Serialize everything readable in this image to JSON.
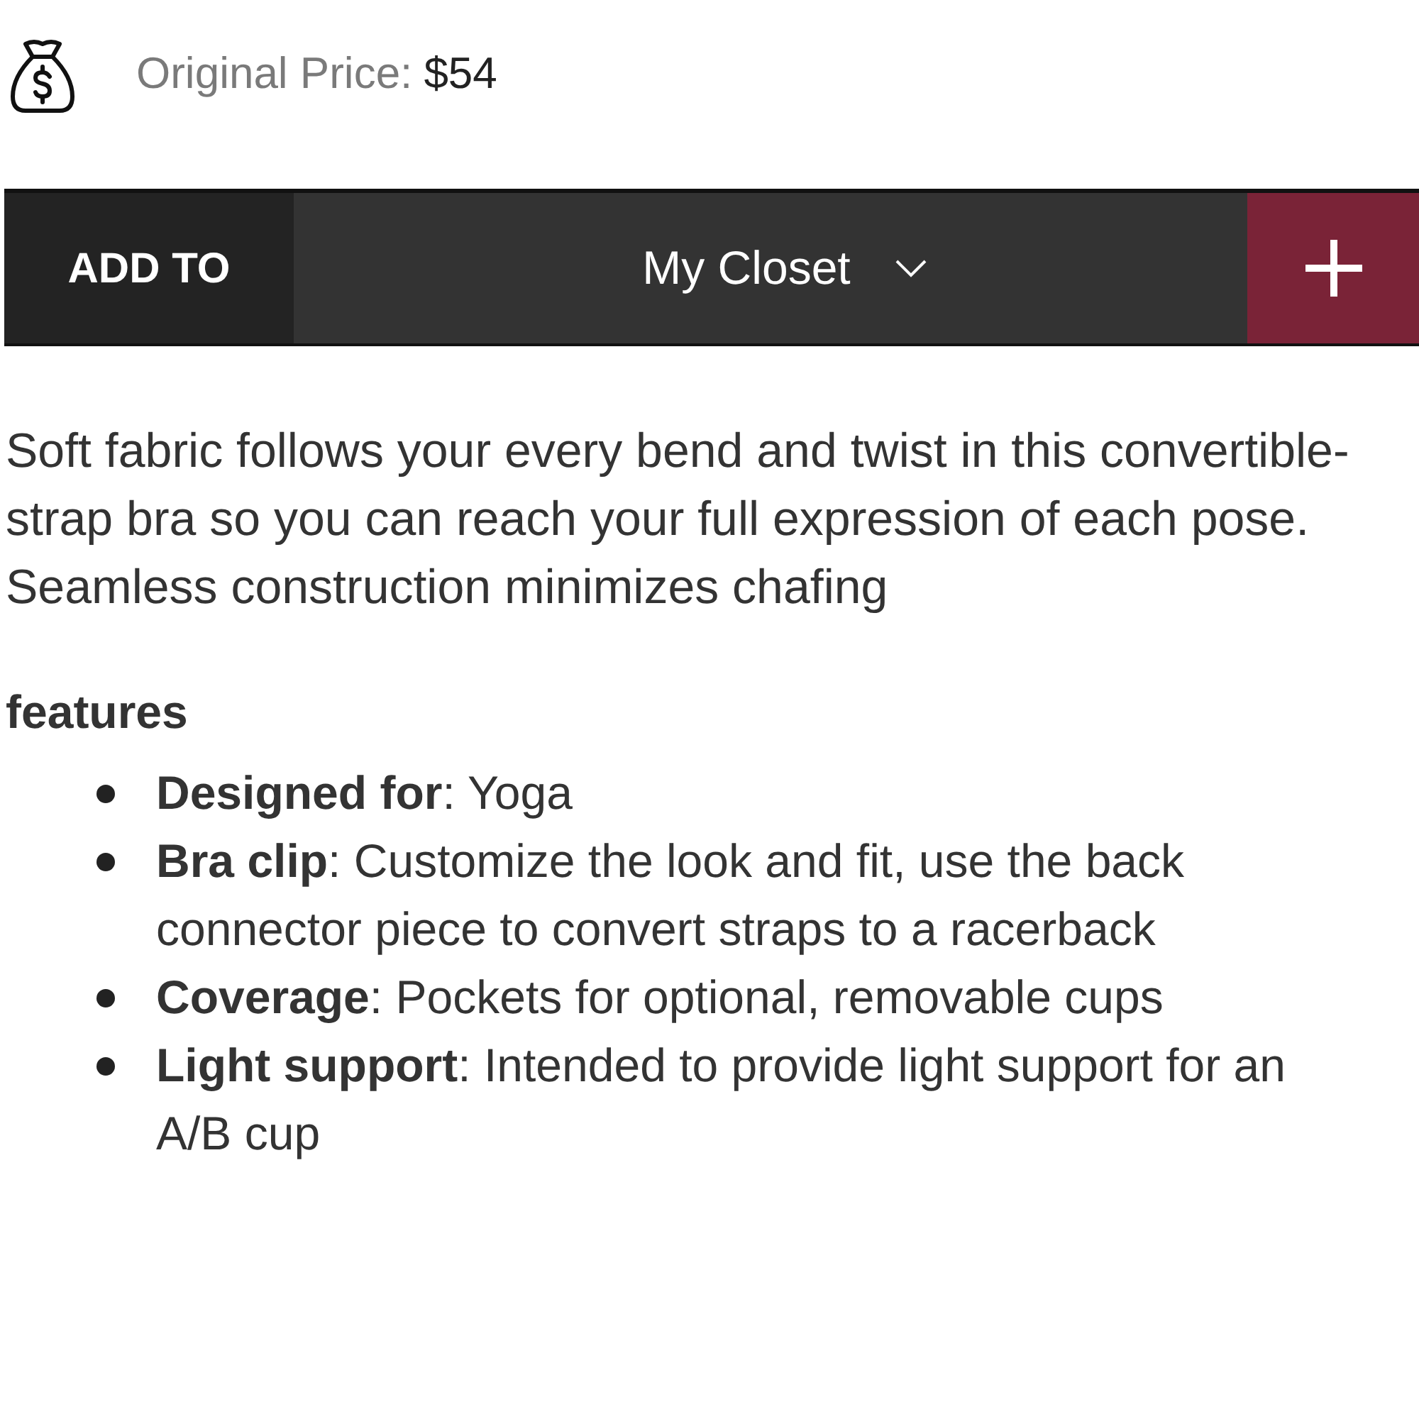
{
  "price": {
    "label": "Original Price:",
    "value": "$54"
  },
  "add_bar": {
    "label": "ADD TO",
    "closet_select": {
      "value": "My Closet"
    }
  },
  "description": "Soft fabric follows your every bend and twist in this convertible-strap bra so you can reach your full expression of each pose. Seamless construction minimizes chafing",
  "features": {
    "heading": "features",
    "items": [
      "**Designed for**: Yoga",
      "**Bra clip**: Customize the look and fit, use the back connector piece to convert straps to a racerback",
      "**Coverage**: Pockets for optional, removable cups",
      "**Light support**: Intended to provide light support for an A/B cup"
    ]
  }
}
